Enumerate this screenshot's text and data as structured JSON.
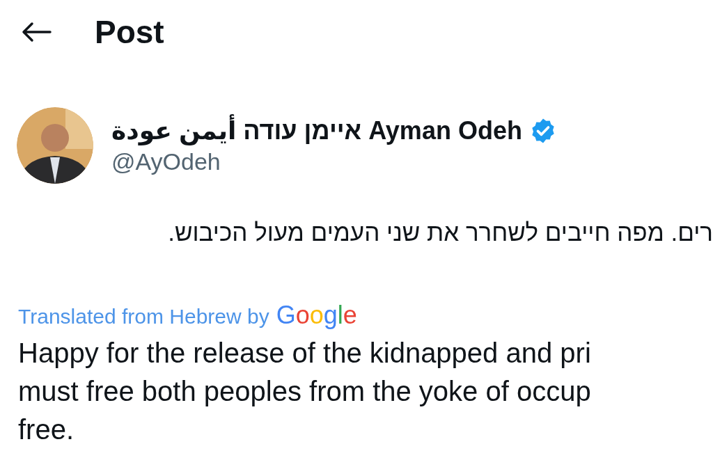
{
  "header": {
    "title": "Post"
  },
  "author": {
    "display_name": "Ayman Odeh איימן עודה أيمن عودة",
    "verified": true,
    "handle": "@AyOdeh"
  },
  "post": {
    "original_text": "רים. מפה חייבים לשחרר את שני העמים מעול הכיבוש.",
    "translation_label": "Translated from Hebrew by",
    "translation_brand": "Google",
    "translated_lines": [
      "Happy for the release of the kidnapped and pri",
      "must free both peoples from the yoke of occup",
      "free."
    ]
  }
}
